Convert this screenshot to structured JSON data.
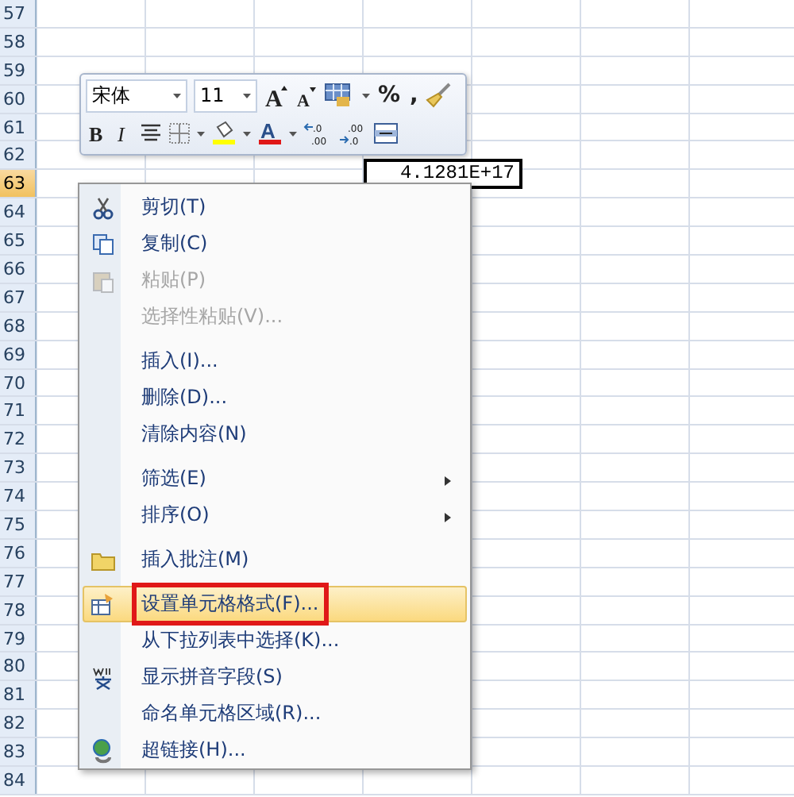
{
  "sheet": {
    "rows": [
      {
        "label": "57",
        "selected": false
      },
      {
        "label": "58",
        "selected": false
      },
      {
        "label": "59",
        "selected": false
      },
      {
        "label": "60",
        "selected": false
      },
      {
        "label": "61",
        "selected": false
      },
      {
        "label": "62",
        "selected": false
      },
      {
        "label": "63",
        "selected": true
      },
      {
        "label": "64",
        "selected": false
      },
      {
        "label": "65",
        "selected": false
      },
      {
        "label": "66",
        "selected": false
      },
      {
        "label": "67",
        "selected": false
      },
      {
        "label": "68",
        "selected": false
      },
      {
        "label": "69",
        "selected": false
      },
      {
        "label": "70",
        "selected": false
      },
      {
        "label": "71",
        "selected": false
      },
      {
        "label": "72",
        "selected": false
      },
      {
        "label": "73",
        "selected": false
      },
      {
        "label": "74",
        "selected": false
      },
      {
        "label": "75",
        "selected": false
      },
      {
        "label": "76",
        "selected": false
      },
      {
        "label": "77",
        "selected": false
      },
      {
        "label": "78",
        "selected": false
      },
      {
        "label": "79",
        "selected": false
      },
      {
        "label": "80",
        "selected": false
      },
      {
        "label": "81",
        "selected": false
      },
      {
        "label": "82",
        "selected": false
      },
      {
        "label": "83",
        "selected": false
      },
      {
        "label": "84",
        "selected": false
      }
    ],
    "active_cell": {
      "value": "4.1281E+17"
    }
  },
  "mini_toolbar": {
    "font": "宋体",
    "size": "11",
    "grow_font": "A",
    "shrink_font": "A",
    "percent": "%",
    "comma": ",",
    "bold": "B",
    "italic": "I",
    "font_color": "A",
    "increase_decimal": [
      ".0",
      ".00"
    ],
    "decrease_decimal": [
      ".00",
      ".0"
    ]
  },
  "context_menu": {
    "items": [
      {
        "kind": "item",
        "label": "剪切(T)",
        "disabled": false,
        "selected": false,
        "submenu": false,
        "annotated": false
      },
      {
        "kind": "item",
        "label": "复制(C)",
        "disabled": false,
        "selected": false,
        "submenu": false,
        "annotated": false
      },
      {
        "kind": "item",
        "label": "粘贴(P)",
        "disabled": true,
        "selected": false,
        "submenu": false,
        "annotated": false
      },
      {
        "kind": "item",
        "label": "选择性粘贴(V)...",
        "disabled": true,
        "selected": false,
        "submenu": false,
        "annotated": false
      },
      {
        "kind": "separator"
      },
      {
        "kind": "item",
        "label": "插入(I)...",
        "disabled": false,
        "selected": false,
        "submenu": false,
        "annotated": false
      },
      {
        "kind": "item",
        "label": "删除(D)...",
        "disabled": false,
        "selected": false,
        "submenu": false,
        "annotated": false
      },
      {
        "kind": "item",
        "label": "清除内容(N)",
        "disabled": false,
        "selected": false,
        "submenu": false,
        "annotated": false
      },
      {
        "kind": "separator"
      },
      {
        "kind": "item",
        "label": "筛选(E)",
        "disabled": false,
        "selected": false,
        "submenu": true,
        "annotated": false
      },
      {
        "kind": "item",
        "label": "排序(O)",
        "disabled": false,
        "selected": false,
        "submenu": true,
        "annotated": false
      },
      {
        "kind": "separator"
      },
      {
        "kind": "item",
        "label": "插入批注(M)",
        "disabled": false,
        "selected": false,
        "submenu": false,
        "annotated": false
      },
      {
        "kind": "separator"
      },
      {
        "kind": "item",
        "label": "设置单元格格式(F)...",
        "disabled": false,
        "selected": true,
        "submenu": false,
        "annotated": true
      },
      {
        "kind": "item",
        "label": "从下拉列表中选择(K)...",
        "disabled": false,
        "selected": false,
        "submenu": false,
        "annotated": false
      },
      {
        "kind": "item",
        "label": "显示拼音字段(S)",
        "disabled": false,
        "selected": false,
        "submenu": false,
        "annotated": false
      },
      {
        "kind": "item",
        "label": "命名单元格区域(R)...",
        "disabled": false,
        "selected": false,
        "submenu": false,
        "annotated": false
      },
      {
        "kind": "item",
        "label": "超链接(H)...",
        "disabled": false,
        "selected": false,
        "submenu": false,
        "annotated": false
      }
    ]
  }
}
